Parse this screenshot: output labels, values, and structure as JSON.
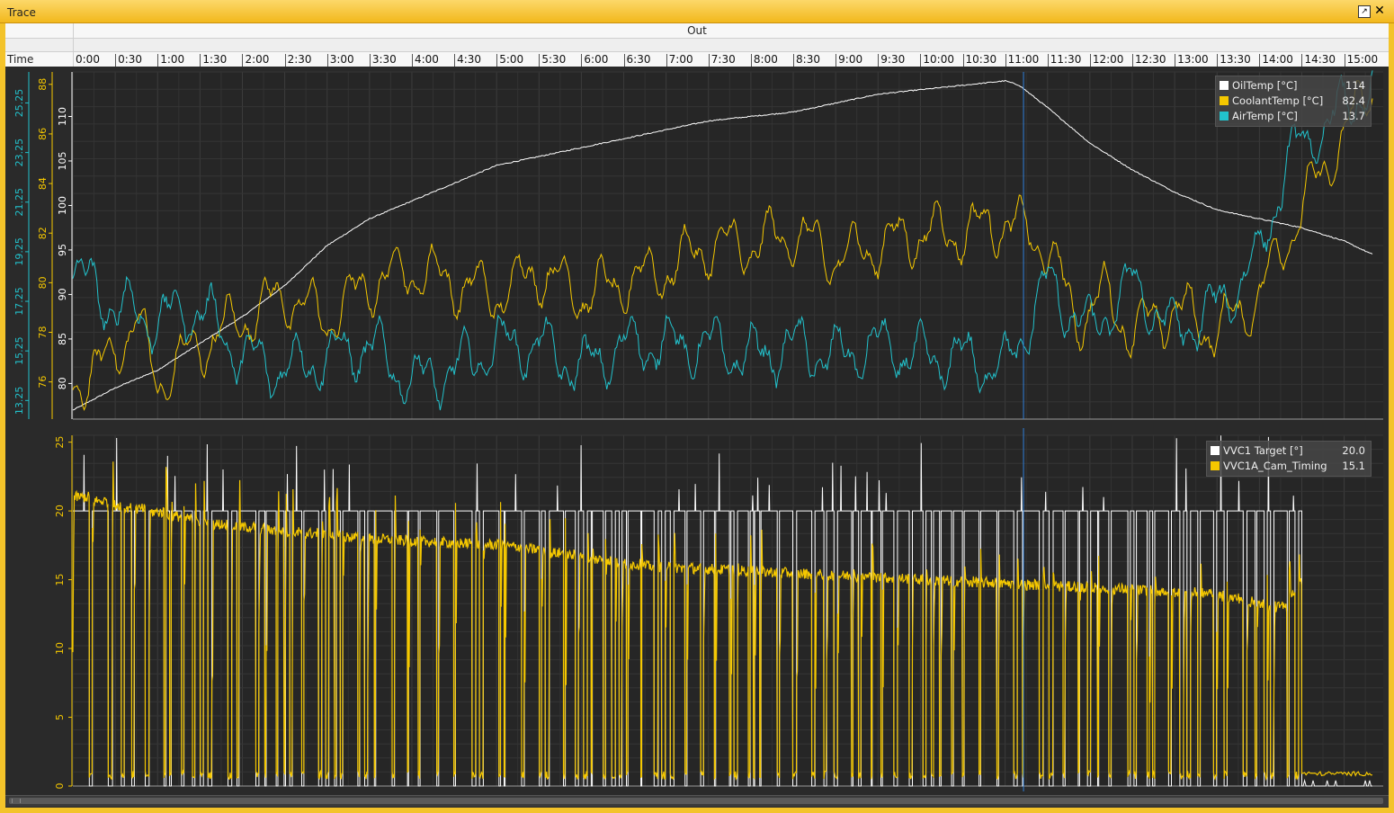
{
  "window": {
    "title": "Trace"
  },
  "header": {
    "series_name": "Out",
    "time_label": "Time"
  },
  "time_axis": {
    "ticks": [
      "0:00",
      "0:30",
      "1:00",
      "1:30",
      "2:00",
      "2:30",
      "3:00",
      "3:30",
      "4:00",
      "4:30",
      "5:00",
      "5:30",
      "6:00",
      "6:30",
      "7:00",
      "7:30",
      "8:00",
      "8:30",
      "9:00",
      "9:30",
      "10:00",
      "10:30",
      "11:00",
      "11:30",
      "12:00",
      "12:30",
      "13:00",
      "13:30",
      "14:00",
      "14:30",
      "15:00"
    ],
    "range_seconds": [
      0,
      920
    ],
    "cursor_time": "11:13"
  },
  "legend_top": [
    {
      "name": "OilTemp [°C]",
      "value": "114",
      "color": "#ffffff"
    },
    {
      "name": "CoolantTemp [°C]",
      "value": "82.4",
      "color": "#f5c800"
    },
    {
      "name": "AirTemp [°C]",
      "value": "13.7",
      "color": "#22c2cc"
    }
  ],
  "legend_bottom": [
    {
      "name": "VVC1 Target [°]",
      "value": "20.0",
      "color": "#ffffff"
    },
    {
      "name": "VVC1A_Cam_Timing",
      "value": "15.1",
      "color": "#f5c800"
    }
  ],
  "chart_data": [
    {
      "type": "line",
      "x_unit": "seconds",
      "xlim": [
        0,
        920
      ],
      "axes": [
        {
          "series": "AirTemp [°C]",
          "ylim": [
            12.5,
            26.5
          ],
          "ticks": [
            "13.25",
            "15.25",
            "17.25",
            "19.25",
            "21.25",
            "23.25",
            "25.25"
          ],
          "color": "#22c2cc"
        },
        {
          "series": "CoolantTemp [°C]",
          "ylim": [
            74.5,
            88.5
          ],
          "ticks": [
            "76",
            "78",
            "80",
            "82",
            "84",
            "86",
            "88"
          ],
          "color": "#f5c800"
        },
        {
          "series": "OilTemp [°C]",
          "ylim": [
            76,
            115
          ],
          "ticks": [
            "80",
            "85",
            "90",
            "95",
            "100",
            "105",
            "110"
          ],
          "color": "#ffffff"
        }
      ],
      "series": [
        {
          "name": "OilTemp [°C]",
          "x": [
            0,
            30,
            60,
            90,
            120,
            150,
            180,
            210,
            240,
            270,
            300,
            330,
            360,
            390,
            420,
            450,
            480,
            510,
            540,
            570,
            600,
            630,
            660,
            670,
            690,
            720,
            750,
            780,
            810,
            840,
            870,
            900,
            920
          ],
          "y": [
            77,
            79.5,
            81.5,
            84.5,
            87.5,
            91,
            95.5,
            98.5,
            100.5,
            102.5,
            104.5,
            105.5,
            106.5,
            107.5,
            108.5,
            109.5,
            110,
            110.5,
            111.5,
            112.5,
            113,
            113.5,
            114,
            113.5,
            111,
            107,
            104,
            101.5,
            99.5,
            98.5,
            97.5,
            96,
            94.5
          ]
        },
        {
          "name": "CoolantTemp [°C]",
          "x": [
            0,
            20,
            45,
            60,
            90,
            120,
            150,
            180,
            210,
            240,
            270,
            300,
            330,
            360,
            390,
            420,
            450,
            480,
            510,
            540,
            570,
            600,
            630,
            660,
            690,
            710,
            730,
            750,
            780,
            810,
            840,
            870,
            900,
            920
          ],
          "y": [
            76,
            76.5,
            78.5,
            76,
            77.5,
            78.5,
            79.5,
            78.5,
            80,
            80.5,
            80,
            79.5,
            80.5,
            79.5,
            80,
            80.5,
            81.5,
            81.5,
            82,
            81,
            81.5,
            82,
            82,
            82.5,
            81.5,
            78.5,
            79.5,
            78,
            79,
            78,
            79.5,
            83,
            86,
            88
          ]
        },
        {
          "name": "AirTemp [°C]",
          "x": [
            0,
            30,
            60,
            90,
            120,
            150,
            180,
            210,
            240,
            270,
            300,
            330,
            360,
            390,
            420,
            450,
            480,
            510,
            540,
            570,
            600,
            630,
            660,
            690,
            720,
            750,
            780,
            810,
            840,
            860,
            880,
            900,
            920
          ],
          "y": [
            18.5,
            17,
            16.5,
            17,
            15,
            14.5,
            15,
            15.5,
            14,
            14.5,
            15.5,
            15.5,
            14.5,
            15.5,
            15.5,
            15.5,
            15,
            15.5,
            15,
            15.5,
            15,
            15,
            14.5,
            18,
            16,
            18,
            16,
            17,
            19,
            23,
            24,
            25,
            26
          ]
        }
      ]
    },
    {
      "type": "line",
      "x_unit": "seconds",
      "xlim": [
        0,
        920
      ],
      "ylim": [
        0,
        25.5
      ],
      "yticks": [
        "0",
        "5",
        "10",
        "15",
        "20",
        "25"
      ],
      "series": [
        {
          "name": "VVC1 Target [°]",
          "description_levels": [
            0,
            20
          ],
          "x": [
            0,
            870,
            880,
            920
          ],
          "y": [
            20,
            20,
            0,
            0
          ]
        },
        {
          "name": "VVC1A_Cam_Timing",
          "x": [
            0,
            100,
            200,
            300,
            400,
            500,
            600,
            700,
            800,
            850,
            870,
            880,
            920
          ],
          "y": [
            21,
            19,
            18,
            17.5,
            16,
            15.5,
            15,
            14.5,
            14,
            13,
            15,
            1,
            1
          ]
        }
      ]
    }
  ]
}
